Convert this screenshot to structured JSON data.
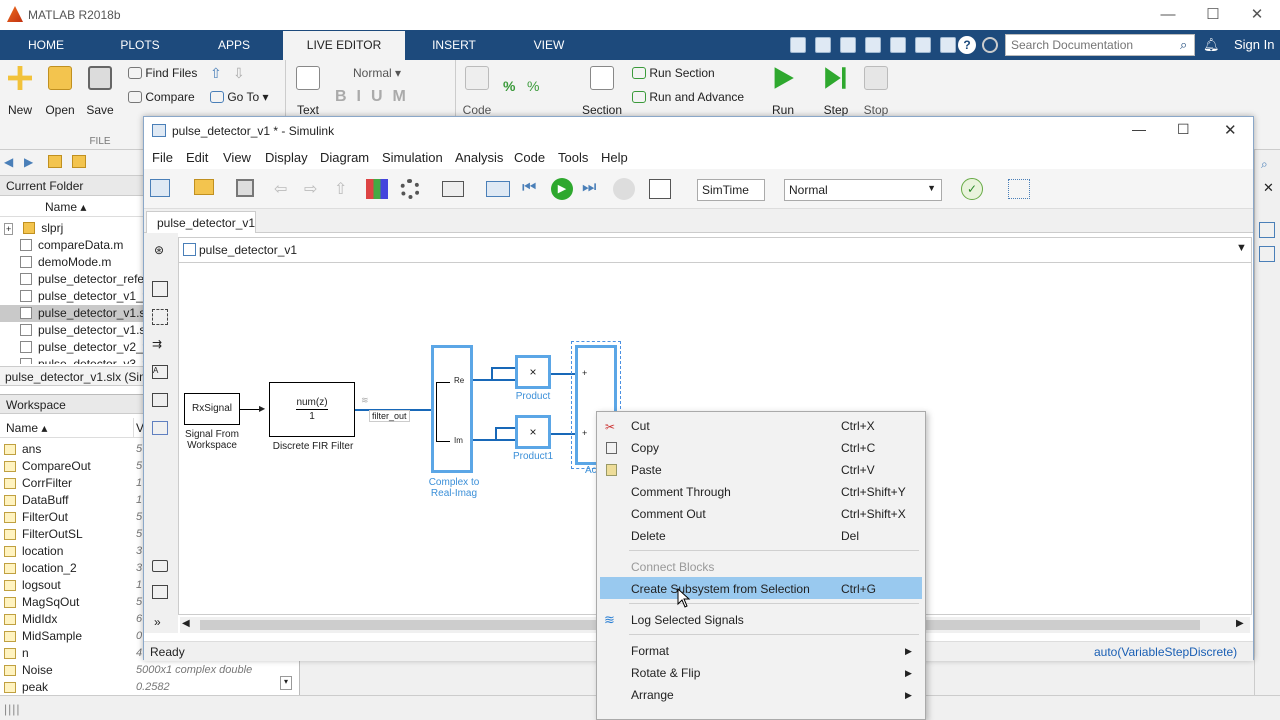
{
  "window": {
    "title": "MATLAB R2018b"
  },
  "ribbon_tabs": [
    "HOME",
    "PLOTS",
    "APPS",
    "LIVE EDITOR",
    "INSERT",
    "VIEW"
  ],
  "search": {
    "placeholder": "Search Documentation"
  },
  "signin": "Sign In",
  "ribbon": {
    "new": "New",
    "open": "Open",
    "save": "Save",
    "find_files": "Find Files",
    "compare": "Compare",
    "go_to": "Go To",
    "file_section": "FILE",
    "text": "Text",
    "style": "Normal",
    "code": "Code",
    "section": "Section",
    "run_section": "Run Section",
    "run_advance": "Run and Advance",
    "run": "Run",
    "step": "Step",
    "stop": "Stop"
  },
  "current_folder": {
    "header": "Current Folder",
    "col_name": "Name",
    "items": [
      "slprj",
      "compareData.m",
      "demoMode.m",
      "pulse_detector_refe",
      "pulse_detector_v1_t",
      "pulse_detector_v1.s",
      "pulse_detector_v1.s",
      "pulse_detector_v2_t",
      "pulse_detector_v3_t"
    ],
    "status": "pulse_detector_v1.slx (Sim"
  },
  "workspace": {
    "header": "Workspace",
    "col_name": "Name",
    "col_value": "V",
    "rows": [
      {
        "name": "ans",
        "value": "5"
      },
      {
        "name": "CompareOut",
        "value": "5"
      },
      {
        "name": "CorrFilter",
        "value": "1"
      },
      {
        "name": "DataBuff",
        "value": "1"
      },
      {
        "name": "FilterOut",
        "value": "5"
      },
      {
        "name": "FilterOutSL",
        "value": "5"
      },
      {
        "name": "location",
        "value": "3"
      },
      {
        "name": "location_2",
        "value": "3"
      },
      {
        "name": "logsout",
        "value": "1"
      },
      {
        "name": "MagSqOut",
        "value": "5"
      },
      {
        "name": "MidIdx",
        "value": "6"
      },
      {
        "name": "MidSample",
        "value": "0"
      },
      {
        "name": "n",
        "value": "4"
      },
      {
        "name": "Noise",
        "value": "5000x1 complex double"
      },
      {
        "name": "peak",
        "value": "0.2582"
      }
    ]
  },
  "simulink": {
    "title": "pulse_detector_v1 * - Simulink",
    "menu": [
      "File",
      "Edit",
      "View",
      "Display",
      "Diagram",
      "Simulation",
      "Analysis",
      "Code",
      "Tools",
      "Help"
    ],
    "sim_time": "SimTime",
    "sim_mode": "Normal",
    "model_tab": "pulse_detector_v1",
    "breadcrumb": "pulse_detector_v1",
    "status_left": "Ready",
    "status_right": "auto(VariableStepDiscrete)",
    "blocks": {
      "rx_signal": "RxSignal",
      "rx_label1": "Signal From",
      "rx_label2": "Workspace",
      "fir_num": "num(z)",
      "fir_den": "1",
      "fir_label": "Discrete FIR Filter",
      "signal_name": "filter_out",
      "cri_re": "Re",
      "cri_im": "Im",
      "cri_label1": "Complex to",
      "cri_label2": "Real-Imag",
      "product": "Product",
      "product1": "Product1",
      "product_sym": "×",
      "add_label": "Ac",
      "plus": "+"
    }
  },
  "context_menu": {
    "items": [
      {
        "label": "Cut",
        "shortcut": "Ctrl+X"
      },
      {
        "label": "Copy",
        "shortcut": "Ctrl+C"
      },
      {
        "label": "Paste",
        "shortcut": "Ctrl+V"
      },
      {
        "label": "Comment Through",
        "shortcut": "Ctrl+Shift+Y"
      },
      {
        "label": "Comment Out",
        "shortcut": "Ctrl+Shift+X"
      },
      {
        "label": "Delete",
        "shortcut": "Del"
      },
      {
        "label": "Connect Blocks",
        "shortcut": ""
      },
      {
        "label": "Create Subsystem from Selection",
        "shortcut": "Ctrl+G"
      },
      {
        "label": "Log Selected Signals",
        "shortcut": ""
      },
      {
        "label": "Format",
        "shortcut": ""
      },
      {
        "label": "Rotate & Flip",
        "shortcut": ""
      },
      {
        "label": "Arrange",
        "shortcut": ""
      }
    ]
  }
}
